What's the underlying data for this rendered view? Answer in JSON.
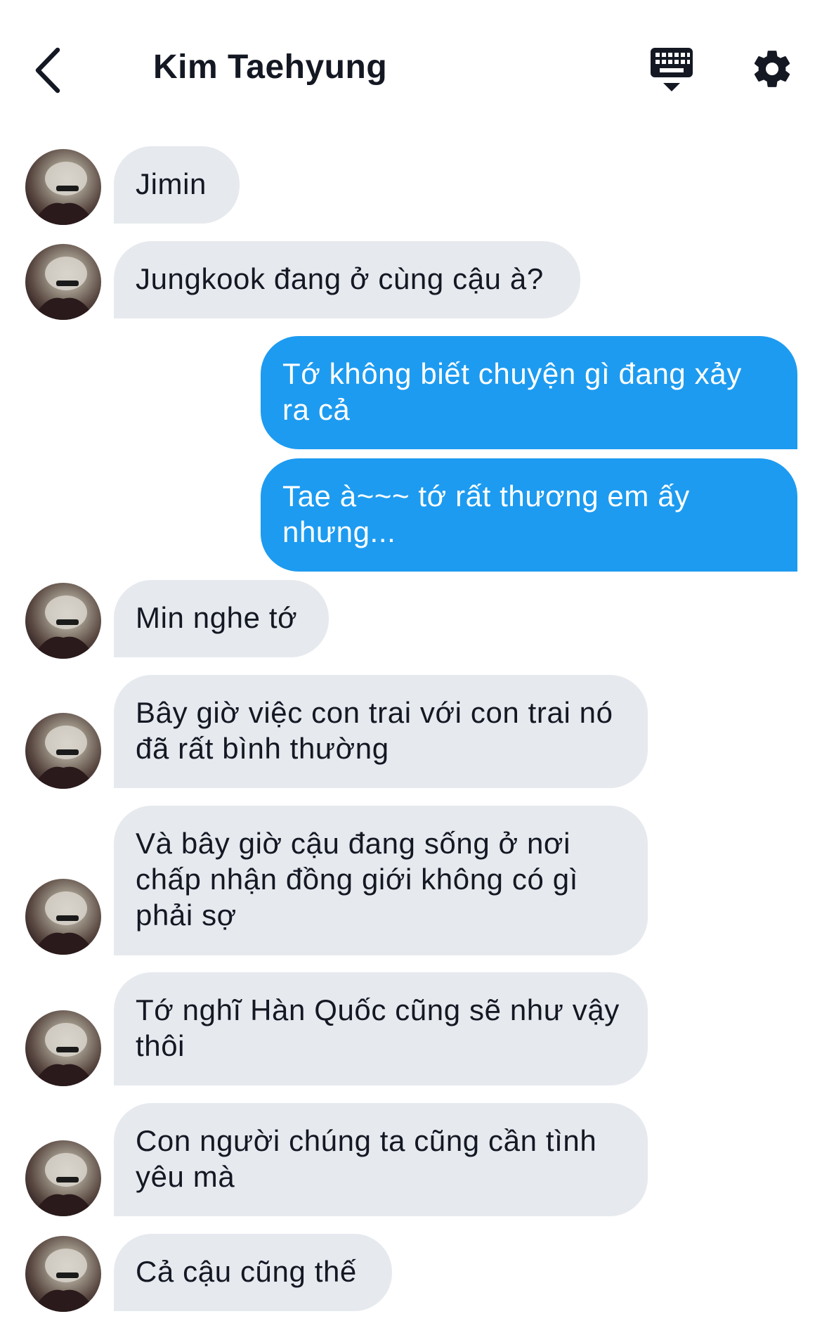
{
  "header": {
    "title": "Kim Taehyung",
    "back_icon": "chevron-left-icon",
    "keyboard_icon": "keyboard-icon",
    "settings_icon": "gear-icon"
  },
  "colors": {
    "incoming_bubble": "#e6e9ee",
    "outgoing_bubble": "#1d9bf0",
    "text": "#141823"
  },
  "messages": [
    {
      "side": "incoming",
      "text": "Jimin"
    },
    {
      "side": "incoming",
      "text": "Jungkook đang ở cùng cậu à?"
    },
    {
      "side": "outgoing",
      "text": "Tớ không biết chuyện gì đang xảy ra cả"
    },
    {
      "side": "outgoing",
      "text": "Tae à~~~ tớ rất thương em ấy nhưng..."
    },
    {
      "side": "incoming",
      "text": "Min nghe tớ"
    },
    {
      "side": "incoming",
      "text": "Bây giờ việc con trai với con trai nó đã rất bình thường"
    },
    {
      "side": "incoming",
      "text": "Và bây giờ cậu đang sống ở nơi chấp nhận đồng giới không có gì phải sợ"
    },
    {
      "side": "incoming",
      "text": "Tớ nghĩ Hàn Quốc cũng sẽ như vậy thôi"
    },
    {
      "side": "incoming",
      "text": "Con người chúng ta cũng cần tình yêu mà"
    },
    {
      "side": "incoming",
      "text": "Cả cậu cũng thế"
    }
  ]
}
